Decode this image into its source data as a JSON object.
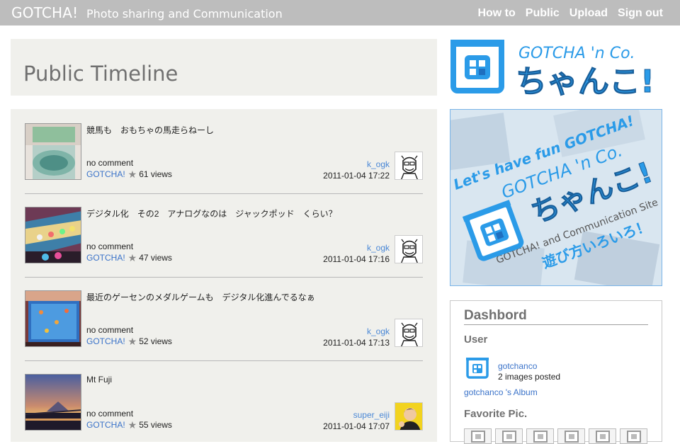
{
  "header": {
    "brand": "GOTCHA!",
    "subtitle": "Photo sharing and Communication",
    "nav": [
      "How to",
      "Public",
      "Upload",
      "Sign out"
    ]
  },
  "page_title": "Public Timeline",
  "timeline": [
    {
      "caption": "競馬も　おもちゃの馬走らねーし",
      "comments": "no comment",
      "tag": "GOTCHA!",
      "views": "61 views",
      "user": "k_ogk",
      "time": "2011-01-04 17:22"
    },
    {
      "caption": "デジタル化　その2　アナログなのは　ジャックポッド　くらい？",
      "comments": "no comment",
      "tag": "GOTCHA!",
      "views": "47 views",
      "user": "k_ogk",
      "time": "2011-01-04 17:16"
    },
    {
      "caption": "最近のゲーセンのメダルゲームも　デジタル化進んでるなぁ",
      "comments": "no comment",
      "tag": "GOTCHA!",
      "views": "52 views",
      "user": "k_ogk",
      "time": "2011-01-04 17:13"
    },
    {
      "caption": "Mt Fuji",
      "comments": "no comment",
      "tag": "GOTCHA!",
      "views": "55 views",
      "user": "super_eiji",
      "time": "2011-01-04 17:07"
    }
  ],
  "logo": {
    "top": "GOTCHA 'n Co.",
    "main": "ちゃんこ!"
  },
  "banner": {
    "line1": "Let's have fun GOTCHA!",
    "line2": "GOTCHA 'n Co.",
    "line3": "ちゃんこ!",
    "line4": "GOTCHA! and Communication Site",
    "line5": "遊び方いろいろ！"
  },
  "dashboard": {
    "title": "Dashbord",
    "user_heading": "User",
    "user_name": "gotchanco",
    "images_posted": "2 images posted",
    "album_link": "gotchanco 's Album",
    "favorite_heading": "Favorite Pic."
  },
  "colors": {
    "topbar": "#bdbdbd",
    "panel": "#f0f0ec",
    "link": "#3b73c9",
    "brand_blue": "#2b9be8"
  }
}
